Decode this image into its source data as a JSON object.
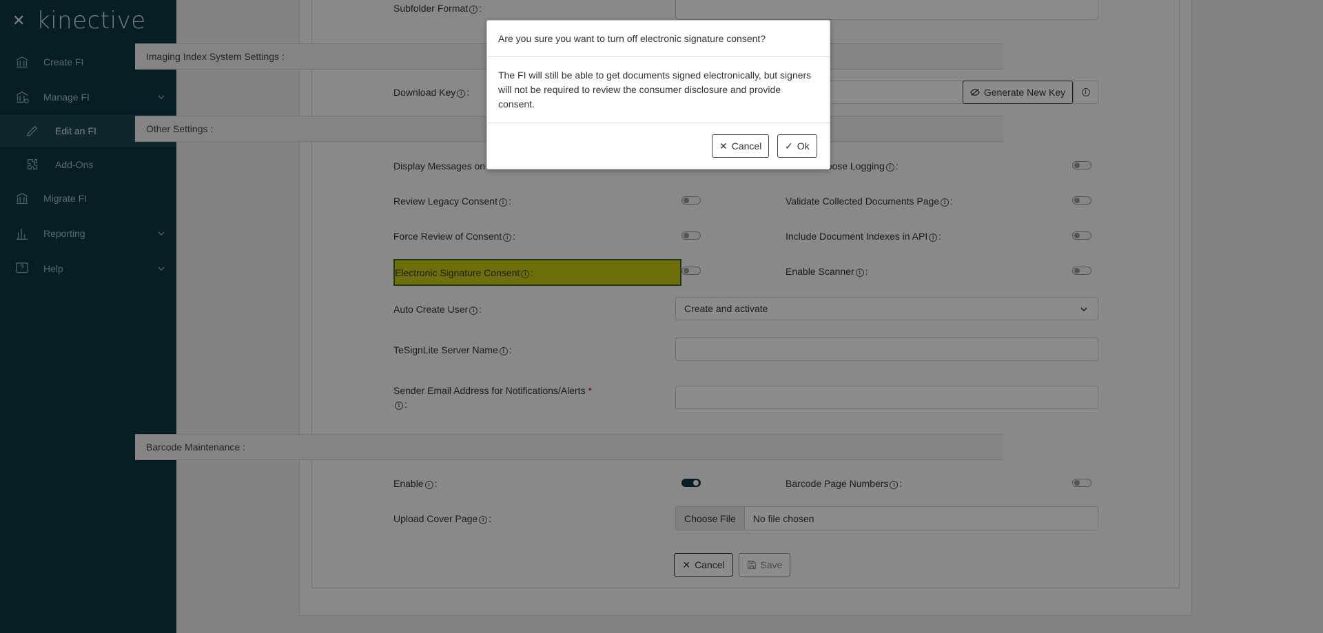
{
  "sidebar": {
    "logo": "kinective",
    "items": [
      {
        "label": "Create FI",
        "icon": "bank-icon"
      },
      {
        "label": "Manage FI",
        "icon": "bank-icon"
      },
      {
        "label": "Edit an FI",
        "icon": "pencil-icon"
      },
      {
        "label": "Add-Ons",
        "icon": "puzzle-icon"
      },
      {
        "label": "Migrate FI",
        "icon": "bank-icon"
      },
      {
        "label": "Reporting",
        "icon": "bar-chart-icon"
      },
      {
        "label": "Help",
        "icon": "help-chat-icon"
      }
    ]
  },
  "form": {
    "subfolder_format": "Subfolder Format",
    "imaging_index_section": "Imaging Index System Settings :",
    "download_key": "Download Key",
    "generate_key": "Generate New Key",
    "other_settings_section": "Other Settings :",
    "display_messages": "Display Messages on",
    "verbose_logging": "rbose Logging",
    "review_legacy": "Review Legacy Consent",
    "validate_collected": "Validate Collected Documents Page",
    "force_review": "Force Review of Consent",
    "include_indexes": "Include Document Indexes in API",
    "esign_consent": "Electronic Signature Consent",
    "enable_scanner": "Enable Scanner",
    "auto_create_user": "Auto Create User",
    "auto_create_value": "Create and activate",
    "tesignlite_server": "TeSignLite Server Name",
    "sender_email": "Sender Email Address for Notifications/Alerts",
    "required_mark": "*",
    "barcode_section": "Barcode Maintenance :",
    "enable": "Enable",
    "barcode_page_numbers": "Barcode Page Numbers",
    "upload_cover_page": "Upload Cover Page",
    "choose_file": "Choose File",
    "no_file": "No file chosen",
    "cancel": "Cancel",
    "save": "Save",
    "colon": ":"
  },
  "modal": {
    "title": "Are you sure you want to turn off electronic signature consent?",
    "body": "The FI will still be able to get documents signed electronically, but signers will not be required to review the consumer disclosure and provide consent.",
    "cancel": "Cancel",
    "ok": "Ok"
  },
  "colors": {
    "sidebar": "#0f3844",
    "highlight": "#c9cb14"
  }
}
